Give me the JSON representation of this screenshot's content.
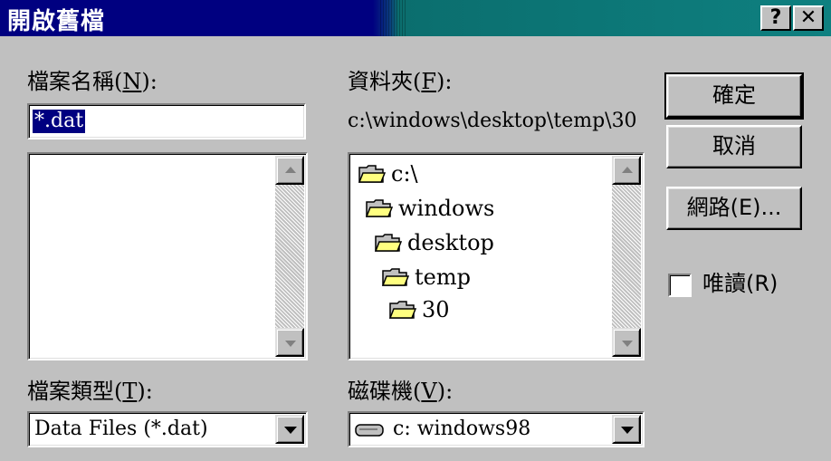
{
  "window": {
    "title": "開啟舊檔",
    "help_label": "?",
    "close_label": "✕"
  },
  "filename": {
    "label_pre": "檔案名稱(",
    "label_mnemonic": "N",
    "label_post": "):",
    "value": "*.dat"
  },
  "folder": {
    "label_pre": "資料夾(",
    "label_mnemonic": "F",
    "label_post": "):",
    "path": "c:\\windows\\desktop\\temp\\30"
  },
  "directories": [
    {
      "name": "c:\\",
      "icon": "open-folder-icon"
    },
    {
      "name": "windows",
      "icon": "open-folder-icon"
    },
    {
      "name": "desktop",
      "icon": "open-folder-icon"
    },
    {
      "name": "temp",
      "icon": "open-folder-icon"
    },
    {
      "name": "30",
      "icon": "open-folder-icon"
    }
  ],
  "buttons": {
    "ok": "確定",
    "cancel": "取消",
    "network": "網路(E)..."
  },
  "readonly": {
    "label": "唯讀(R)",
    "checked": false
  },
  "file_type": {
    "label_pre": "檔案類型(",
    "label_mnemonic": "T",
    "label_post": "):",
    "value": "Data Files (*.dat)"
  },
  "drive": {
    "label_pre": "磁碟機(",
    "label_mnemonic": "V",
    "label_post": "):",
    "value": "c: windows98",
    "icon": "hard-drive-icon"
  },
  "colors": {
    "titlebar_start": "#000080",
    "titlebar_end": "#0e8080",
    "face": "#c0c0c0",
    "selection": "#000080"
  }
}
